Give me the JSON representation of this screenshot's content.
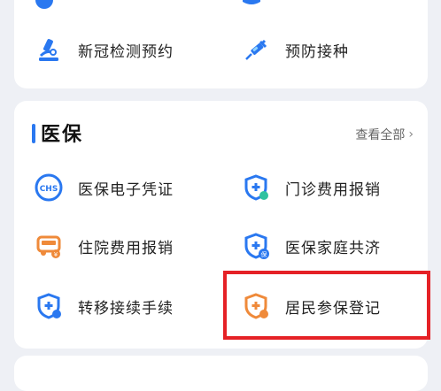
{
  "colors": {
    "accent": "#2a78f0",
    "orange": "#ef8a3a",
    "highlight": "#e52126"
  },
  "top_section": {
    "items": [
      {
        "label": "新冠检测预约",
        "icon": "microscope-icon"
      },
      {
        "label": "预防接种",
        "icon": "syringe-icon"
      }
    ]
  },
  "medical_insurance": {
    "title": "医保",
    "view_all": "查看全部",
    "items": [
      {
        "label": "医保电子凭证",
        "icon": "chs-badge-icon"
      },
      {
        "label": "门诊费用报销",
        "icon": "shield-plus-icon"
      },
      {
        "label": "住院费用报销",
        "icon": "ambulance-icon"
      },
      {
        "label": "医保家庭共济",
        "icon": "shield-plus-family-icon"
      },
      {
        "label": "转移接续手续",
        "icon": "shield-transfer-icon"
      },
      {
        "label": "居民参保登记",
        "icon": "shield-registration-icon"
      }
    ]
  }
}
